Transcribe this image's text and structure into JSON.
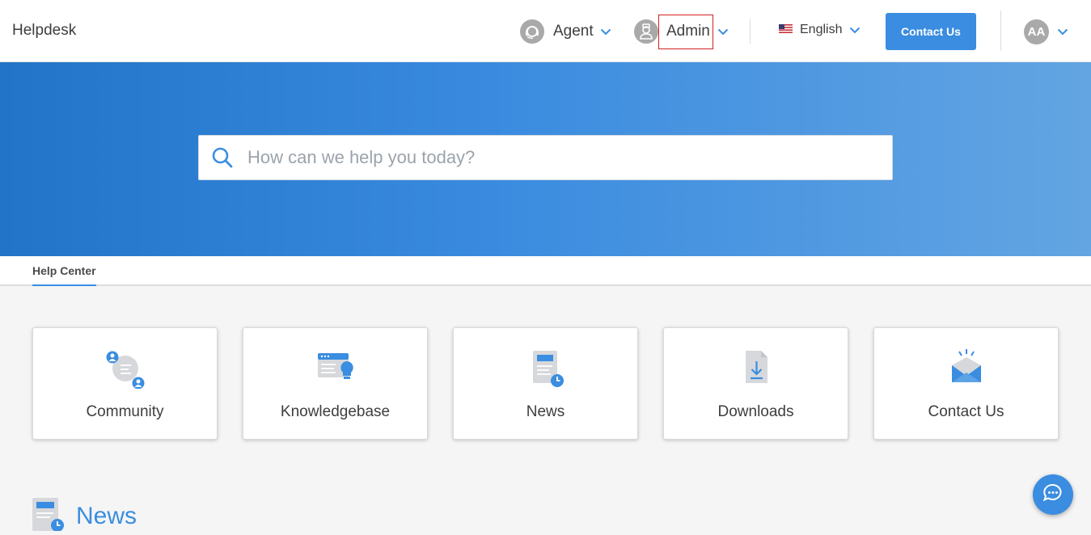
{
  "header": {
    "brand": "Helpdesk",
    "agent_label": "Agent",
    "admin_label": "Admin",
    "language_label": "English",
    "contact_button": "Contact Us",
    "user_initials": "AA"
  },
  "hero": {
    "search_placeholder": "How can we help you today?"
  },
  "subnav": {
    "tab_label": "Help Center"
  },
  "cards": [
    {
      "label": "Community",
      "icon": "community-icon"
    },
    {
      "label": "Knowledgebase",
      "icon": "knowledgebase-icon"
    },
    {
      "label": "News",
      "icon": "news-icon"
    },
    {
      "label": "Downloads",
      "icon": "downloads-icon"
    },
    {
      "label": "Contact Us",
      "icon": "contact-mail-icon"
    }
  ],
  "news_section": {
    "title": "News"
  },
  "colors": {
    "accent": "#3a8de0",
    "highlight_box": "#d6201f",
    "hero_start": "#2174c8",
    "hero_end": "#63a5e2"
  }
}
